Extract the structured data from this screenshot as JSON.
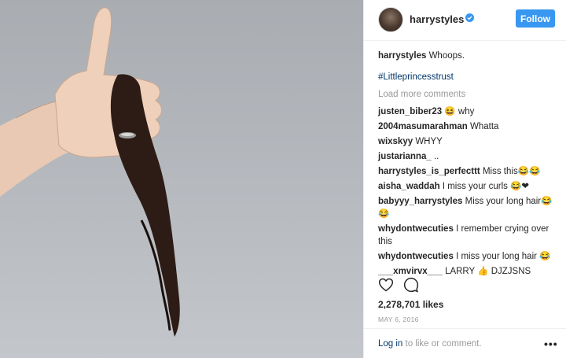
{
  "post": {
    "username": "harrystyles",
    "follow_label": "Follow",
    "caption_text": "Whoops.",
    "hashtag": "#Littleprincesstrust",
    "load_more": "Load more comments",
    "comments": [
      {
        "user": "justen_biber23",
        "text": "😆 why"
      },
      {
        "user": "2004masumarahman",
        "text": "Whatta"
      },
      {
        "user": "wixskyy",
        "text": "WHYY"
      },
      {
        "user": "justarianna_",
        "text": ".."
      },
      {
        "user": "harrystyles_is_perfecttt",
        "text": "Miss this😂😂"
      },
      {
        "user": "aisha_waddah",
        "text": "I miss your curls 😂❤"
      },
      {
        "user": "babyyy_harrystyles",
        "text": "Miss your long hair😂😂"
      },
      {
        "user": "whydontwecuties",
        "text": "I remember crying over this"
      },
      {
        "user": "whydontwecuties",
        "text": "I miss your long hair 😂"
      },
      {
        "user": "___xmvirvx___",
        "text": "LARRY 👍 DJZJSNS"
      }
    ],
    "likes": "2,278,701 likes",
    "date": "MAY 6, 2016",
    "login_link": "Log in",
    "login_rest": " to like or comment.",
    "more_label": "•••"
  },
  "icons": {
    "verified": "verified-badge-icon",
    "like": "heart-icon",
    "comment": "comment-bubble-icon",
    "more": "more-options-icon"
  },
  "colors": {
    "accent": "#3897f0",
    "link": "#003569",
    "muted": "#999999"
  }
}
